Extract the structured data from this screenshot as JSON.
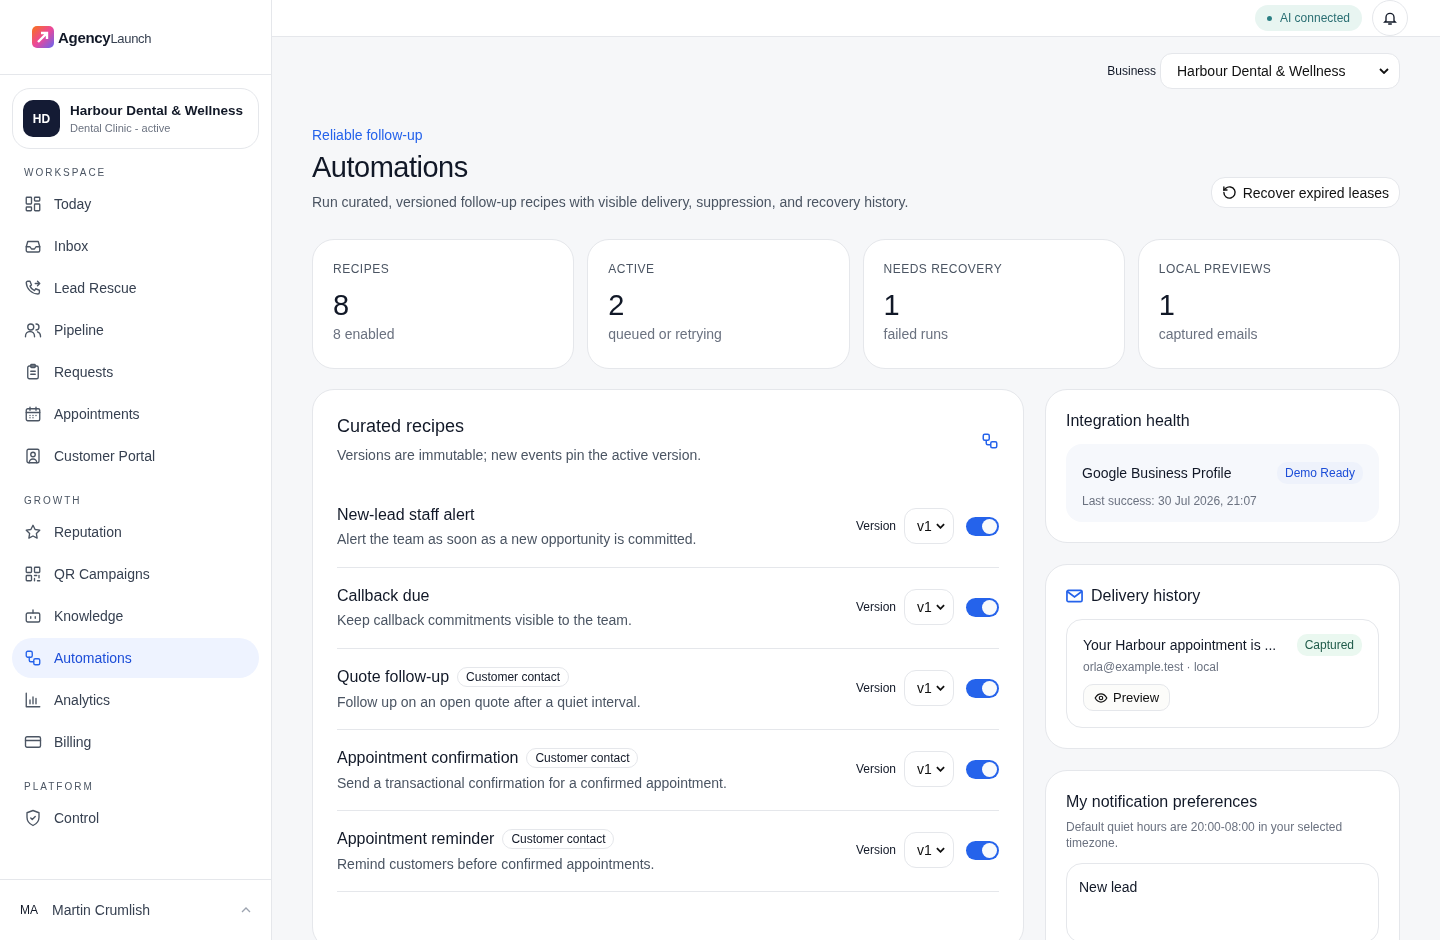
{
  "brand": {
    "name": "Agency",
    "suffix": "Launch"
  },
  "business_card": {
    "initials": "HD",
    "name": "Harbour Dental & Wellness",
    "subtitle": "Dental Clinic - active"
  },
  "sidebar": {
    "sections": [
      {
        "title": "WORKSPACE",
        "items": [
          {
            "label": "Today",
            "selected": false
          },
          {
            "label": "Inbox",
            "selected": false
          },
          {
            "label": "Lead Rescue",
            "selected": false
          },
          {
            "label": "Pipeline",
            "selected": false
          },
          {
            "label": "Requests",
            "selected": false
          },
          {
            "label": "Appointments",
            "selected": false
          },
          {
            "label": "Customer Portal",
            "selected": false
          }
        ]
      },
      {
        "title": "GROWTH",
        "items": [
          {
            "label": "Reputation",
            "selected": false
          },
          {
            "label": "QR Campaigns",
            "selected": false
          },
          {
            "label": "Knowledge",
            "selected": false
          },
          {
            "label": "Automations",
            "selected": true
          },
          {
            "label": "Analytics",
            "selected": false
          },
          {
            "label": "Billing",
            "selected": false
          }
        ]
      },
      {
        "title": "PLATFORM",
        "items": [
          {
            "label": "Control",
            "selected": false
          }
        ]
      }
    ]
  },
  "user": {
    "initials": "MA",
    "name": "Martin Crumlish"
  },
  "header": {
    "status": "AI connected"
  },
  "business_select": {
    "label": "Business",
    "value": "Harbour Dental & Wellness"
  },
  "page": {
    "eyebrow": "Reliable follow-up",
    "title": "Automations",
    "description": "Run curated, versioned follow-up recipes with visible delivery, suppression, and recovery history.",
    "action": "Recover expired leases"
  },
  "stats": [
    {
      "label": "RECIPES",
      "value": "8",
      "note": "8 enabled"
    },
    {
      "label": "ACTIVE",
      "value": "2",
      "note": "queued or retrying"
    },
    {
      "label": "NEEDS RECOVERY",
      "value": "1",
      "note": "failed runs"
    },
    {
      "label": "LOCAL PREVIEWS",
      "value": "1",
      "note": "captured emails"
    }
  ],
  "recipes": {
    "title": "Curated recipes",
    "subtitle": "Versions are immutable; new events pin the active version.",
    "items": [
      {
        "name": "New-lead staff alert",
        "description": "Alert the team as soon as a new opportunity is committed.",
        "version_label": "Version",
        "version": "v1",
        "on": true
      },
      {
        "name": "Callback due",
        "description": "Keep callback commitments visible to the team.",
        "version_label": "Version",
        "version": "v1",
        "on": true
      },
      {
        "name": "Quote follow-up",
        "tag": "Customer contact",
        "description": "Follow up on an open quote after a quiet interval.",
        "version_label": "Version",
        "version": "v1",
        "on": true
      },
      {
        "name": "Appointment confirmation",
        "tag": "Customer contact",
        "description": "Send a transactional confirmation for a confirmed appointment.",
        "version_label": "Version",
        "version": "v1",
        "on": true
      },
      {
        "name": "Appointment reminder",
        "tag": "Customer contact",
        "description": "Remind customers before confirmed appointments.",
        "version_label": "Version",
        "version": "v1",
        "on": true
      }
    ]
  },
  "integration": {
    "title": "Integration health",
    "items": [
      {
        "name": "Google Business Profile",
        "status": "Demo Ready",
        "detail": "Last success: 30 Jul 2026, 21:07"
      }
    ]
  },
  "delivery": {
    "title": "Delivery history",
    "items": [
      {
        "subject": "Your Harbour appointment is ...",
        "status": "Captured",
        "meta": "orla@example.test · local",
        "action": "Preview"
      }
    ]
  },
  "notifications": {
    "title": "My notification preferences",
    "description": "Default quiet hours are 20:00-08:00 in your selected timezone.",
    "items": [
      {
        "name": "New lead"
      }
    ]
  }
}
